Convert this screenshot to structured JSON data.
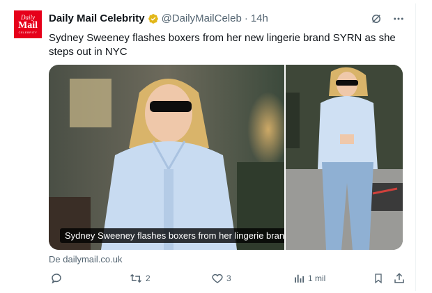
{
  "author": {
    "name": "Daily Mail Celebrity",
    "handle": "@DailyMailCeleb",
    "separator": "·",
    "time": "14h",
    "avatar_line1": "Daily",
    "avatar_line2": "Mail",
    "avatar_line3": "CELEBRITY"
  },
  "tweet": {
    "text": "Sydney Sweeney flashes boxers from her new lingerie brand SYRN as she steps out in NYC"
  },
  "media": {
    "caption": "Sydney Sweeney flashes boxers from her lingerie brand while out in NYC"
  },
  "source": {
    "label": "De dailymail.co.uk"
  },
  "actions": {
    "reply_count": "",
    "retweet_count": "2",
    "like_count": "3",
    "views_count": "1 mil"
  },
  "colors": {
    "brand_red": "#e6001a",
    "verified_gold": "#e2b719",
    "muted": "#536471"
  },
  "icons": [
    "verified-badge-icon",
    "grok-icon",
    "more-icon",
    "reply-icon",
    "retweet-icon",
    "like-icon",
    "views-icon",
    "bookmark-icon",
    "share-icon"
  ]
}
